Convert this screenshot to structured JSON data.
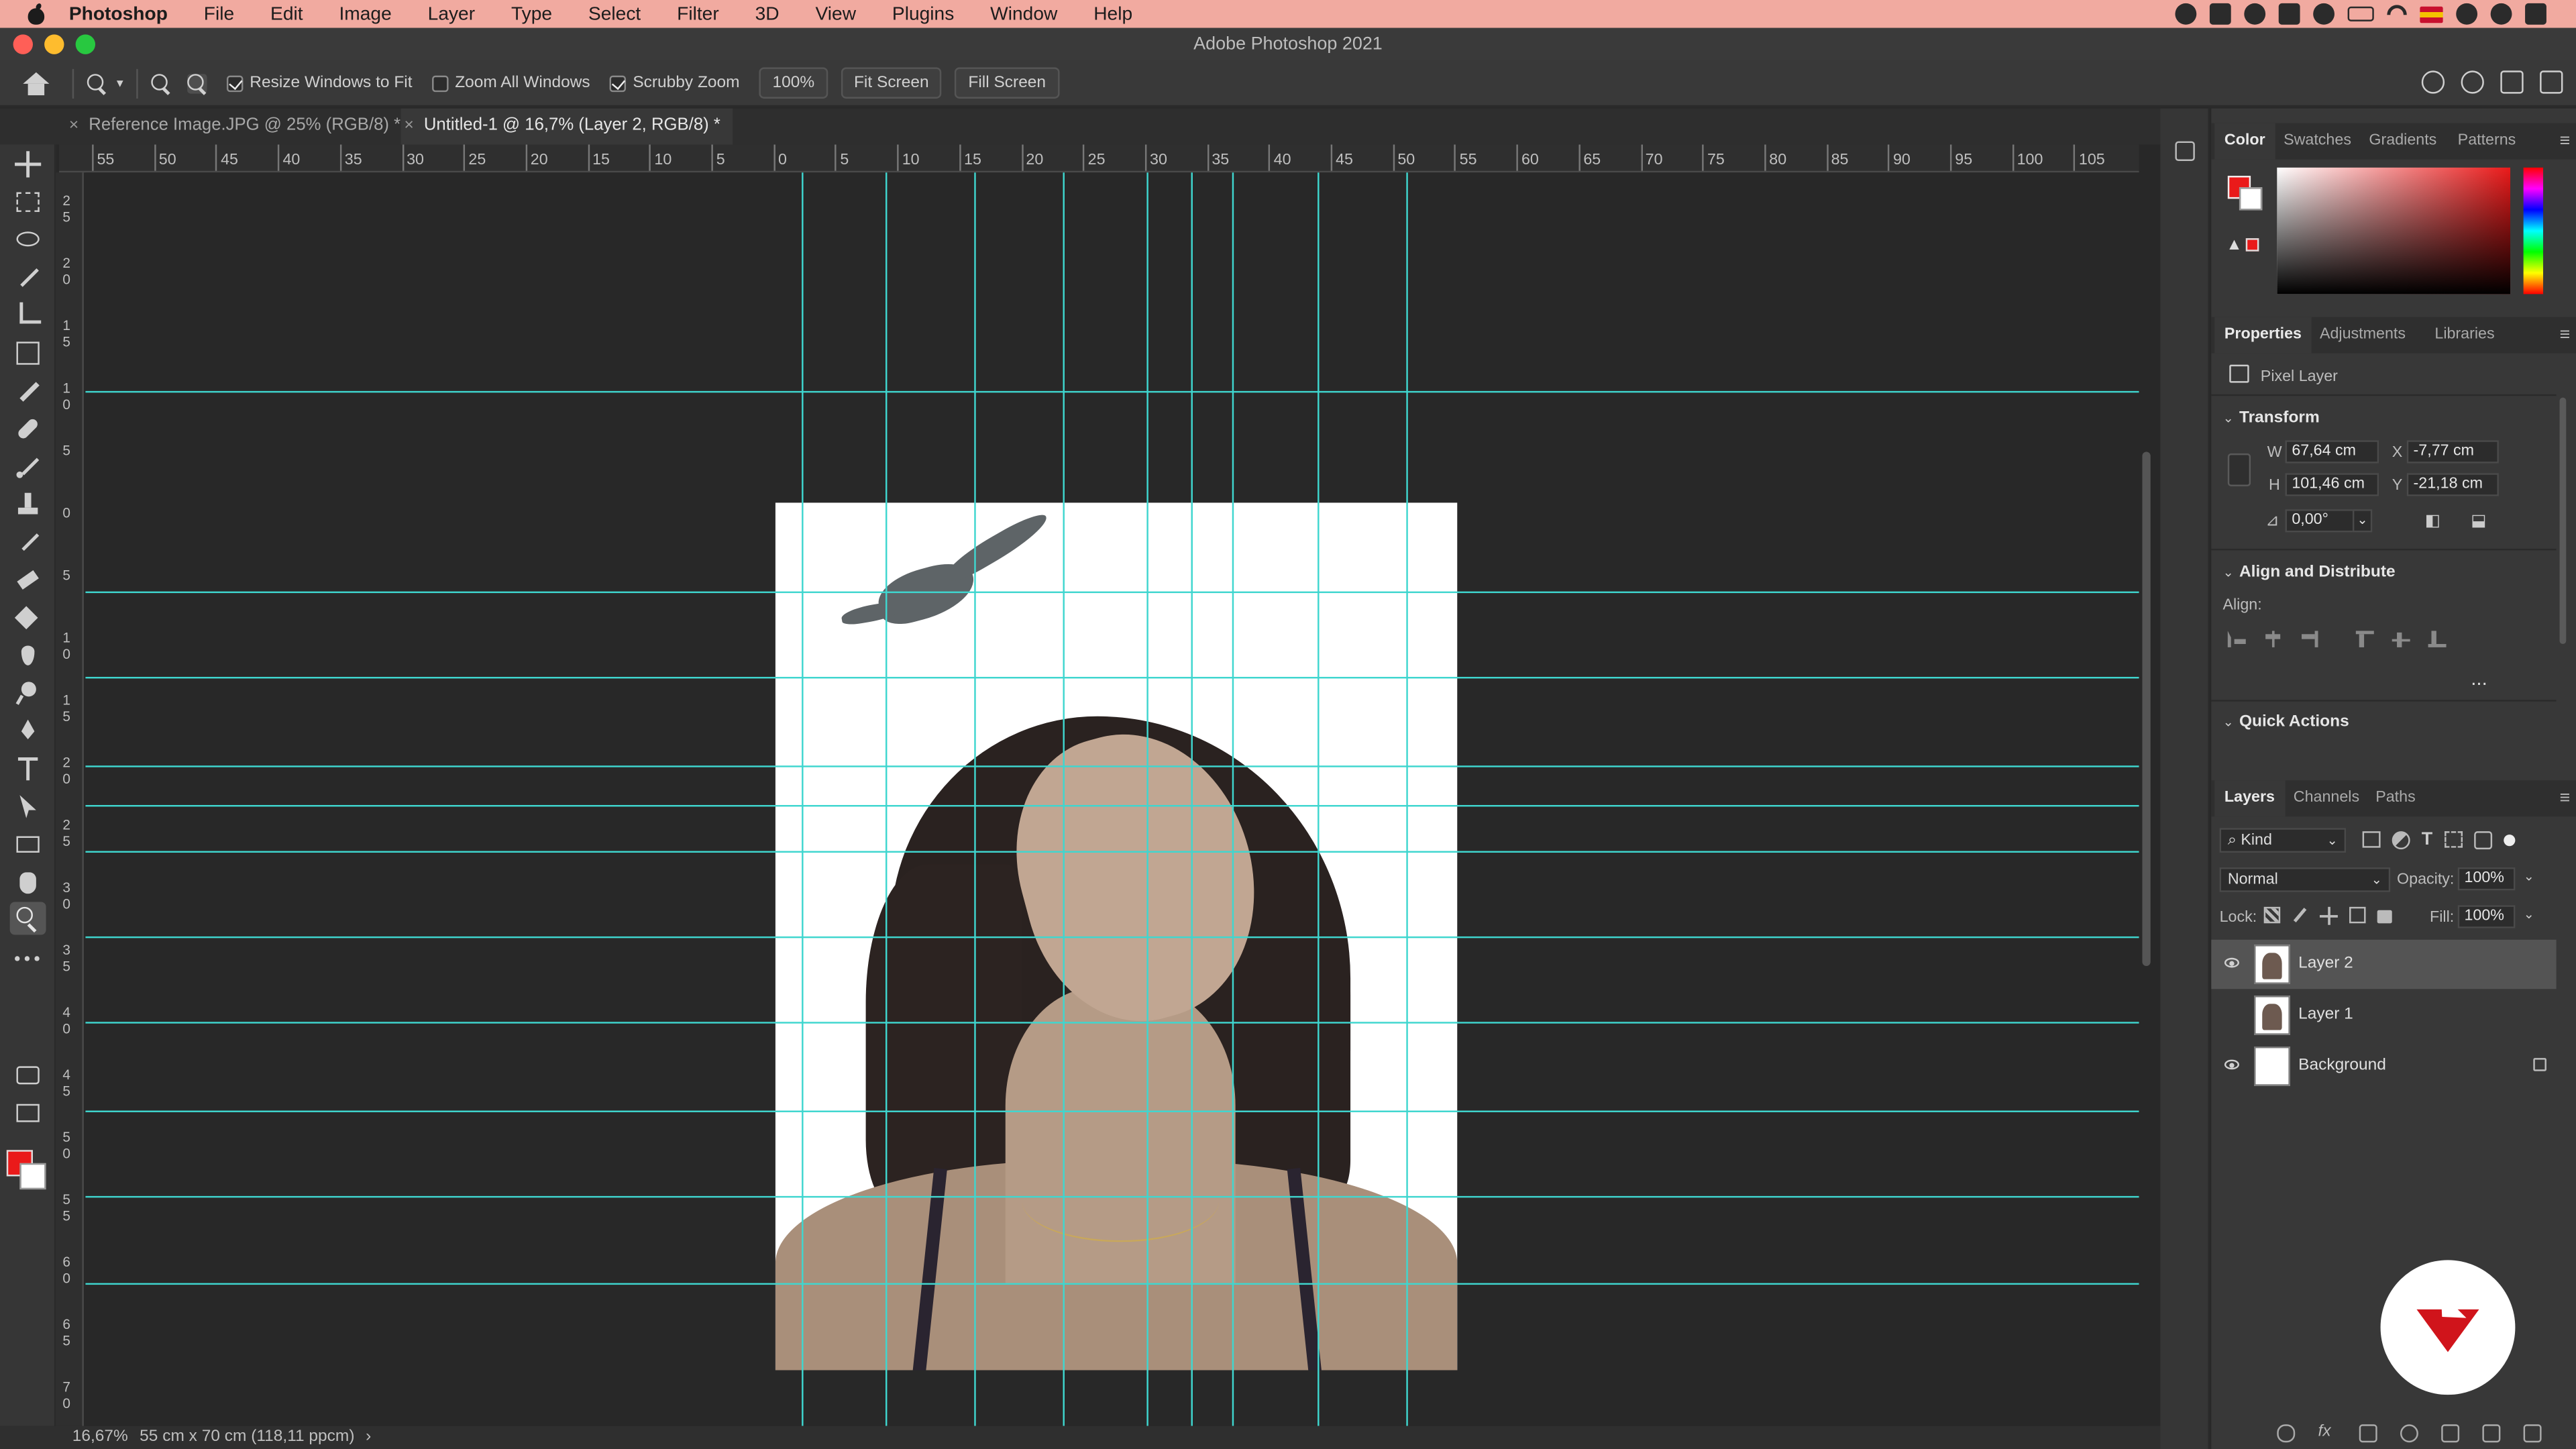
{
  "menubar": {
    "app_name": "Photoshop",
    "items": [
      "File",
      "Edit",
      "Image",
      "Layer",
      "Type",
      "Select",
      "Filter",
      "3D",
      "View",
      "Plugins",
      "Window",
      "Help"
    ]
  },
  "window": {
    "title": "Adobe Photoshop 2021"
  },
  "options_bar": {
    "resize_windows_label": "Resize Windows to Fit",
    "resize_windows_checked": true,
    "zoom_all_label": "Zoom All Windows",
    "zoom_all_checked": false,
    "scrubby_zoom_label": "Scrubby Zoom",
    "scrubby_zoom_checked": true,
    "zoom_percent": "100%",
    "fit_screen_label": "Fit Screen",
    "fill_screen_label": "Fill Screen"
  },
  "tabs": [
    {
      "label": "Reference Image.JPG @ 25% (RGB/8) *",
      "active": false
    },
    {
      "label": "Untitled-1 @ 16,7% (Layer 2, RGB/8) *",
      "active": true
    }
  ],
  "ruler_h_ticks": [
    "55",
    "50",
    "45",
    "40",
    "35",
    "30",
    "25",
    "20",
    "15",
    "10",
    "5",
    "0",
    "5",
    "10",
    "15",
    "20",
    "25",
    "30",
    "35",
    "40",
    "45",
    "50",
    "55",
    "60",
    "65",
    "70",
    "75",
    "80",
    "85",
    "90",
    "95",
    "100",
    "105"
  ],
  "ruler_v_ticks": [
    "2\n5",
    "2\n0",
    "1\n5",
    "1\n0",
    "5",
    "0",
    "5",
    "1\n0",
    "1\n5",
    "2\n0",
    "2\n5",
    "3\n0",
    "3\n5",
    "4\n0",
    "4\n5",
    "5\n0",
    "5\n5",
    "6\n0",
    "6\n5",
    "7\n0"
  ],
  "status_bar": {
    "zoom": "16,67%",
    "doc_info": "55 cm x 70 cm (118,11 ppcm)",
    "arrow": "›"
  },
  "colors": {
    "foreground": "#ea1a1a",
    "background": "#ffffff",
    "guide": "#3fd6cf"
  },
  "color_panel": {
    "tabs": [
      "Color",
      "Swatches",
      "Gradients",
      "Patterns"
    ],
    "active_tab": "Color"
  },
  "properties_panel": {
    "tabs": [
      "Properties",
      "Adjustments",
      "Libraries"
    ],
    "layer_type": "Pixel Layer",
    "transform_title": "Transform",
    "w_label": "W",
    "w_value": "67,64 cm",
    "h_label": "H",
    "h_value": "101,46 cm",
    "x_label": "X",
    "x_value": "-7,77 cm",
    "y_label": "Y",
    "y_value": "-21,18 cm",
    "angle_value": "0,00°",
    "align_title": "Align and Distribute",
    "align_label": "Align:",
    "more": "...",
    "quick_actions_title": "Quick Actions"
  },
  "layers_panel": {
    "tabs": [
      "Layers",
      "Channels",
      "Paths"
    ],
    "filter_kind": "Kind",
    "blend_mode": "Normal",
    "opacity_label": "Opacity:",
    "opacity_value": "100%",
    "lock_label": "Lock:",
    "fill_label": "Fill:",
    "fill_value": "100%",
    "layers": [
      {
        "name": "Layer 2",
        "visible": true,
        "selected": true,
        "locked": false
      },
      {
        "name": "Layer 1",
        "visible": false,
        "selected": false,
        "locked": false
      },
      {
        "name": "Background",
        "visible": true,
        "selected": false,
        "locked": true
      }
    ]
  },
  "tools": [
    "move-tool",
    "marquee-tool",
    "lasso-tool",
    "magic-wand-tool",
    "crop-tool",
    "frame-tool",
    "eyedropper-tool",
    "healing-brush-tool",
    "brush-tool",
    "clone-stamp-tool",
    "history-brush-tool",
    "eraser-tool",
    "paint-bucket-tool",
    "blur-tool",
    "dodge-tool",
    "pen-tool",
    "type-tool",
    "path-selection-tool",
    "rectangle-tool",
    "hand-tool",
    "zoom-tool",
    "more-tools"
  ]
}
